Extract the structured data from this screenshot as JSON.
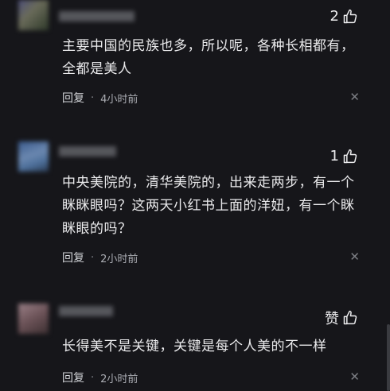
{
  "comments": [
    {
      "text_lines": [
        "主要中国的民族也多，所以呢，各种长相都有，",
        "全都是美人"
      ],
      "likes": "2",
      "reply_label": "回复",
      "time": "4小时前"
    },
    {
      "text_lines": [
        "中央美院的，清华美院的，出来走两步，有一个",
        "眯眯眼吗？这两天小红书上面的洋妞，有一个眯",
        "眯眼的吗？"
      ],
      "likes": "1",
      "reply_label": "回复",
      "time": "2小时前"
    },
    {
      "text_lines": [
        "长得美不是关键，关键是每个人美的不一样"
      ],
      "likes": "赞",
      "reply_label": "回复",
      "time": "2小时前"
    }
  ],
  "separator": "·",
  "colors": {
    "background": "#16161a",
    "text": "#eaeaec",
    "meta": "#a9abb1"
  },
  "icons": {
    "like": "thumbs-up-icon",
    "close": "close-icon"
  }
}
